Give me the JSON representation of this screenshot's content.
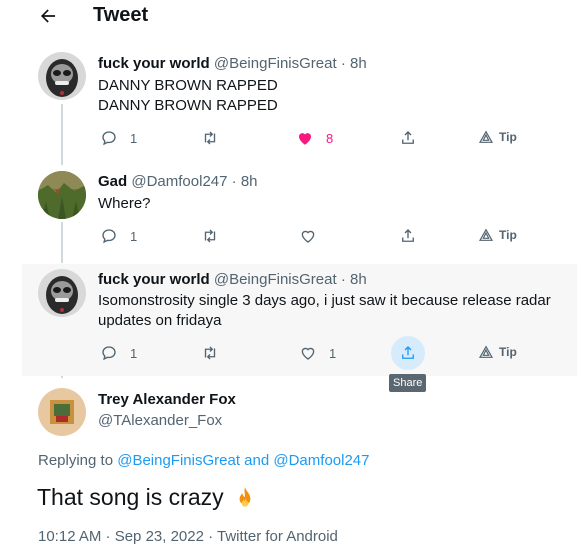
{
  "header": {
    "title": "Tweet"
  },
  "thread": [
    {
      "name": "fuck your world",
      "handle": "@BeingFinisGreat",
      "time": "8h",
      "text": "DANNY BROWN RAPPED\nDANNY BROWN RAPPED",
      "reply_count": "1",
      "retweet_count": "",
      "like_count": "8",
      "liked": true,
      "tip_label": "Tip"
    },
    {
      "name": "Gad",
      "handle": "@Damfool247",
      "time": "8h",
      "text": "Where?",
      "reply_count": "1",
      "retweet_count": "",
      "like_count": "",
      "liked": false,
      "tip_label": "Tip"
    },
    {
      "name": "fuck your world",
      "handle": "@BeingFinisGreat",
      "time": "8h",
      "text": "Isomonstrosity single 3 days ago, i just saw it because release radar updates on fridaya",
      "reply_count": "1",
      "retweet_count": "",
      "like_count": "1",
      "liked": false,
      "tip_label": "Tip",
      "share_tooltip": "Share"
    }
  ],
  "focused": {
    "name": "Trey Alexander Fox",
    "handle": "@TAlexander_Fox",
    "replying_prefix": "Replying to ",
    "replying_user1": "@BeingFinisGreat",
    "replying_and": " and ",
    "replying_user2": "@Damfool247",
    "text": "That song is crazy",
    "timestamp": "10:12 AM · Sep 23, 2022 · Twitter for Android"
  },
  "colors": {
    "accent": "#1d9bf0",
    "like": "#f91880",
    "muted": "#536471",
    "line": "#cfd9de"
  }
}
